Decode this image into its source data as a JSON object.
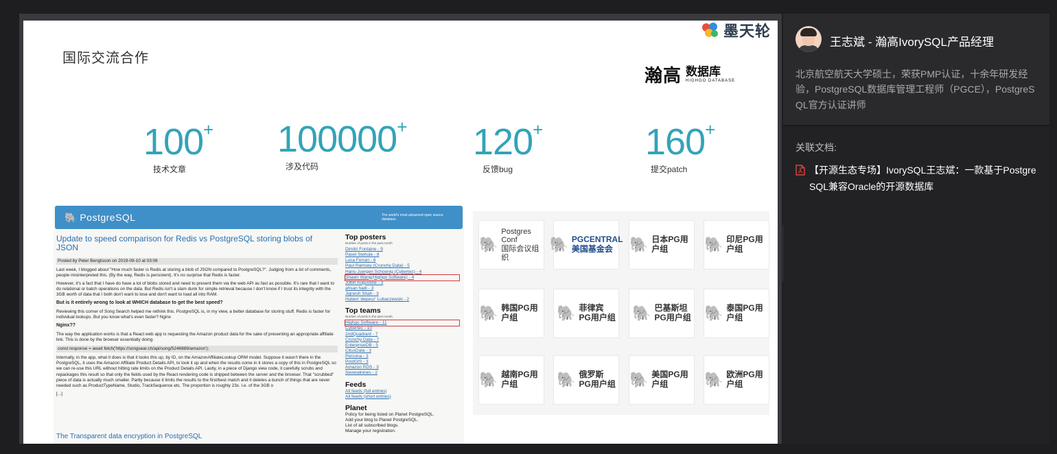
{
  "slide": {
    "title": "国际交流合作",
    "brand": "墨天轮",
    "logo": {
      "name_big": "瀚高",
      "name_small": "数据库",
      "name_en": "HIGHGO DATABASE"
    },
    "stats": [
      {
        "value": "100",
        "suffix": "+",
        "label": "技术文章"
      },
      {
        "value": "100000",
        "suffix": "+",
        "label": "涉及代码"
      },
      {
        "value": "120",
        "suffix": "+",
        "label": "反馈bug"
      },
      {
        "value": "160",
        "suffix": "+",
        "label": "提交patch"
      }
    ],
    "pg": {
      "logo": "PostgreSQL",
      "tagline": "The world's most advanced open source database.",
      "post_title": "Update to speed comparison for Redis vs PostgreSQL storing blobs of JSON",
      "posted_by": "Posted by Peter Bengtsson on 2019-09-10 at 03:06",
      "intro": "Last week, I blogged about \"How much faster is Redis at storing a blob of JSON compared to PostgreSQL?\". Judging from a lot of comments, people misinterpreted this. (By the way, Redis is persistent). It's no surprise that Redis is faster.",
      "p2": "However, it's a fact that I have do have a lot of blobs stored and need to present them via the web API as fast as possible. It's rare that I want to do relational or batch operations on the data. But Redis isn't a slam dunk for simple retrieval because I don't know if I trust its integrity with the 3GB worth of data that I both don't want to lose and don't want to load all into RAM.",
      "h1": "But is it entirely wrong to look at WHICH database to get the best speed?",
      "p3": "Reviewing this corner of Song Search helped me rethink this. PostgreSQL is, in my view, a better database for storing stuff. Redis is faster for individual lookups. But you know what's even faster? Nginx",
      "h2": "Nginx??",
      "p4": "The way the application works is that a React web app is requesting the Amazon product data for the sake of presenting an appropriate affiliate link. This is done by the browser essentially doing:",
      "code": "const response = await fetch('https://songsear.ch/api/song/5246889/amazon');",
      "p5": "Internally, in the app, what it does is that it looks this up, by ID, on the AmazonAffiliateLookup ORM model. Suppose it wasn't there in the PostgreSQL, it uses the Amazon Affiliate Product Details API, to look it up and when the results come in it stores a copy of this in PostgreSQL so we can re-use this URL without hitting rate limits on the Product Details API. Lastly, in a piece of Django view code, it carefully scrubs and repackages this result so that only the fields used by the React rendering code is shipped between the server and the browser. That \"scrubbed\" piece of data is actually much smaller. Partly because it limits the results to the first/best match and it deletes a bunch of things that are never needed such as ProductTypeName, Studio, TrackSequence etc. The proportion is roughly 23x. I.e. of the 3GB o",
      "more": "[...]",
      "bottom_title": "The Transparent data encryption in PostgreSQL",
      "top_posters_title": "Top posters",
      "top_posters_sub": "Number of posts in the past month",
      "top_posters": [
        "Dimitri Fontaine - 9",
        "Pavel Stehule - 8",
        "Luca Ferrari - 6",
        "Paul Ramsey (Crunchy Data) - 5",
        "Hans-Juergen Schoenig (Cybertec) - 4",
        "Shawn Wang(Highgo Software) - 4",
        "Jobin Augustine - 3",
        "ahsan hadi - 3",
        "Jignesh Shah - 3",
        "Hubert 'depesz' Lubaczewski - 2"
      ],
      "top_teams_title": "Top teams",
      "top_teams_sub": "Number of posts in the past month",
      "top_teams": [
        "Highgo Software - 11",
        "Cybertec - 10",
        "2ndQuadrant - 7",
        "Crunchy Data - 7",
        "EnterpriseDB - 5",
        "CitusData - 3",
        "Percona - 3",
        "PostGIS - 3",
        "Amazon RDS - 3",
        "Severalnines - 2"
      ],
      "feeds_title": "Feeds",
      "feeds": [
        "All feeds (full entries)",
        "All feeds (short entries)"
      ],
      "planet_title": "Planet",
      "planet": [
        "Policy for being listed on Planet PostgreSQL.",
        "Add your blog to Planet PostgreSQL.",
        "List of all subscribed blogs.",
        "Manage your registration."
      ]
    },
    "communities": [
      {
        "name": "Postgres Conf\n国际会议组织",
        "icon": "elephant-icon"
      },
      {
        "name": "PGCENTRAL\n美国基金会",
        "icon": "pg-central-icon"
      },
      {
        "name": "日本PG用户组",
        "icon": "elephant-icon"
      },
      {
        "name": "印尼PG用户组",
        "icon": "elephant-icon"
      },
      {
        "name": "韩国PG用户组",
        "icon": "elephant-icon"
      },
      {
        "name": "菲律宾\nPG用户组",
        "icon": "elephant-icon"
      },
      {
        "name": "巴基斯坦\nPG用户组",
        "icon": "elephant-icon"
      },
      {
        "name": "泰国PG用户组",
        "icon": "elephant-icon"
      },
      {
        "name": "越南PG用户组",
        "icon": "elephant-icon"
      },
      {
        "name": "俄罗斯\nPG用户组",
        "icon": "elephant-icon"
      },
      {
        "name": "美国PG用户组",
        "icon": "elephant-icon"
      },
      {
        "name": "欧洲PG用户组",
        "icon": "elephant-icon"
      }
    ]
  },
  "panel": {
    "speaker_name": "王志斌 - 瀚高IvorySQL产品经理",
    "speaker_bio": "北京航空航天大学硕士，荣获PMP认证，十余年研发经验，PostgreSQL数据库管理工程师（PGCE），PostgreSQL官方认证讲师",
    "docs_label": "关联文档:",
    "doc_title": "【开源生态专场】IvorySQL王志斌：一款基于PostgreSQL兼容Oracle的开源数据库",
    "doc_icon": "pdf-icon",
    "collapse_icon": "chevron-right-icon"
  },
  "colors": {
    "accent": "#33a3b8",
    "pg_blue": "#3f8fc8",
    "highlight": "#d23b3b",
    "pdf_red": "#e0443f"
  }
}
